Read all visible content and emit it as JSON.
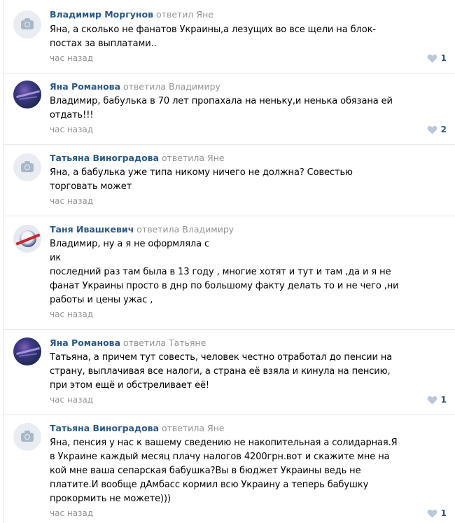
{
  "comments": [
    {
      "avatar": "camera-placeholder-icon",
      "author": "Владимир Моргунов",
      "reply": "ответил Яне",
      "lines": [
        "Яна, а сколько не фанатов Украины,а лезущих во все щели на блок-",
        "постах за выплатами.."
      ],
      "time": "час назад",
      "likes": "1"
    },
    {
      "avatar": "night-sky-photo",
      "author": "Яна Романова",
      "reply": "ответила Владимиру",
      "lines": [
        "Владимир, бабулька в 70 лет пропахала на неньку,и ненька обязана ей",
        "отдать!!!"
      ],
      "time": "час назад",
      "likes": "2"
    },
    {
      "avatar": "camera-placeholder-icon",
      "author": "Татьяна Виноградова",
      "reply": "ответила Яне",
      "lines": [
        "Яна, а бабулька уже типа никому ничего не должна? Совестью",
        "торговать может"
      ],
      "time": "час назад",
      "likes": ""
    },
    {
      "avatar": "football-club-logo",
      "author": "Таня Ивашкевич",
      "reply": "ответила Владимиру",
      "lines": [
        "Владимир, ну а я не оформляла с",
        "ик",
        "последний раз там была в 13 году , многие хотят и тут и там ,да и я не",
        "фанат Украины просто в днр по большому факту делать то и не чего ,ни",
        "работы и цены ужас ,"
      ],
      "time": "час назад",
      "likes": ""
    },
    {
      "avatar": "night-sky-photo",
      "author": "Яна Романова",
      "reply": "ответила Татьяне",
      "lines": [
        "Татьяна, а причем тут совесть, человек честно отработал до пенсии на",
        "страну, выплачивая все налоги, а страна её взяла и кинула на пенсию,",
        "при этом ещё и обстреливает её!"
      ],
      "time": "час назад",
      "likes": "1"
    },
    {
      "avatar": "camera-placeholder-icon",
      "author": "Татьяна Виноградова",
      "reply": "ответила Яне",
      "lines": [
        "Яна, пенсия у нас к вашему сведению не накопительная а солидарная.Я",
        "в Украине каждый месяц плачу налогов 4200грн.вот и скажите мне на",
        "кой мне ваша сепарская бабушка?Вы в бюджет Украины ведь не",
        "платите.И вообще дАмбасс кормил всю Украину а теперь бабушку",
        "прокормить не можете)))"
      ],
      "time": "час назад",
      "likes": "1"
    }
  ],
  "colors": {
    "author": "#2a5885",
    "meta": "#939393",
    "divider": "#e7e8ec",
    "heart": "#bcc7d6"
  }
}
